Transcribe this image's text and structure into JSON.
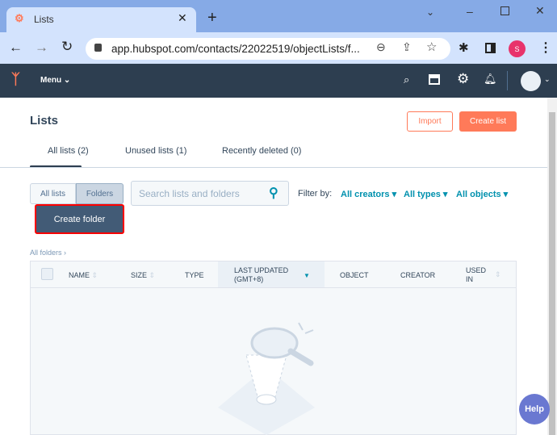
{
  "browser": {
    "tab_title": "Lists",
    "url": "app.hubspot.com/contacts/22022519/objectLists/f...",
    "profile_initial": "S"
  },
  "nav": {
    "menu_label": "Menu"
  },
  "page": {
    "title": "Lists",
    "import_label": "Import",
    "create_list_label": "Create list"
  },
  "tabs": [
    {
      "label": "All lists (2)"
    },
    {
      "label": "Unused lists (1)"
    },
    {
      "label": "Recently deleted (0)"
    }
  ],
  "view_toggle": {
    "all_lists": "All lists",
    "folders": "Folders"
  },
  "search": {
    "placeholder": "Search lists and folders"
  },
  "filters": {
    "label": "Filter by:",
    "creators": "All creators",
    "types": "All types",
    "objects": "All objects"
  },
  "create_folder_label": "Create folder",
  "breadcrumb": "All folders",
  "columns": {
    "name": "NAME",
    "size": "SIZE",
    "type": "TYPE",
    "last_updated": "LAST UPDATED",
    "last_updated_tz": "(GMT+8)",
    "object": "OBJECT",
    "creator": "CREATOR",
    "used_in": "USED",
    "used_in2": "IN"
  },
  "help_label": "Help"
}
